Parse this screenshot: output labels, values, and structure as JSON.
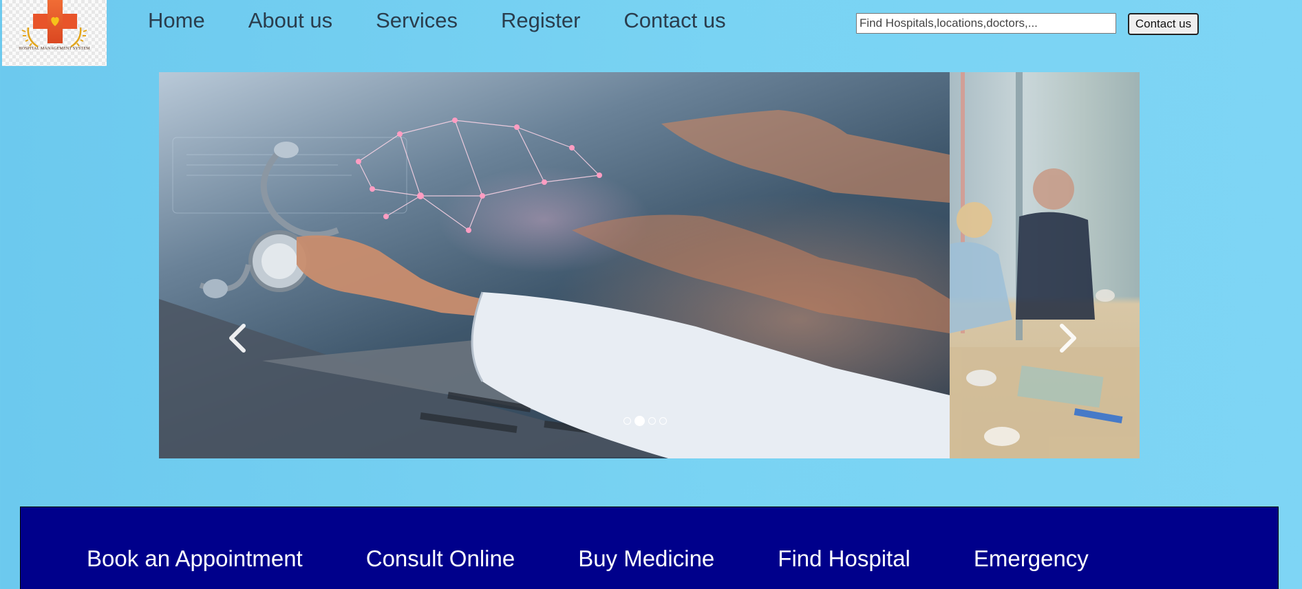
{
  "logo": {
    "icon": "red-cross-heart-icon",
    "text": "HOSPITAL MANAGEMENT SYSTEM",
    "colors": {
      "cross": "#e8542a",
      "heart": "#f6c21a",
      "wreath": "#e3a51b"
    }
  },
  "nav": {
    "items": [
      {
        "label": "Home"
      },
      {
        "label": "About us"
      },
      {
        "label": "Services"
      },
      {
        "label": "Register"
      },
      {
        "label": "Contact us"
      }
    ]
  },
  "search": {
    "placeholder": "Find Hospitals,locations,doctors,...",
    "button_label": "Contact us"
  },
  "carousel": {
    "prev_icon": "chevron-left-icon",
    "next_icon": "chevron-right-icon",
    "slide_count": 4,
    "active_slide": 2,
    "slides": [
      {
        "image": "doctor-stethoscope-laptop-brain-hologram-image"
      },
      {
        "image": "business-meeting-office-image"
      }
    ]
  },
  "quick_links": {
    "items": [
      {
        "label": "Book an Appointment"
      },
      {
        "label": "Consult Online"
      },
      {
        "label": "Buy Medicine"
      },
      {
        "label": "Find Hospital"
      },
      {
        "label": "Emergency"
      }
    ]
  },
  "colors": {
    "page_background": "#79d3f3",
    "bottom_bar": "#00008b",
    "nav_text": "#2a3d4d"
  }
}
